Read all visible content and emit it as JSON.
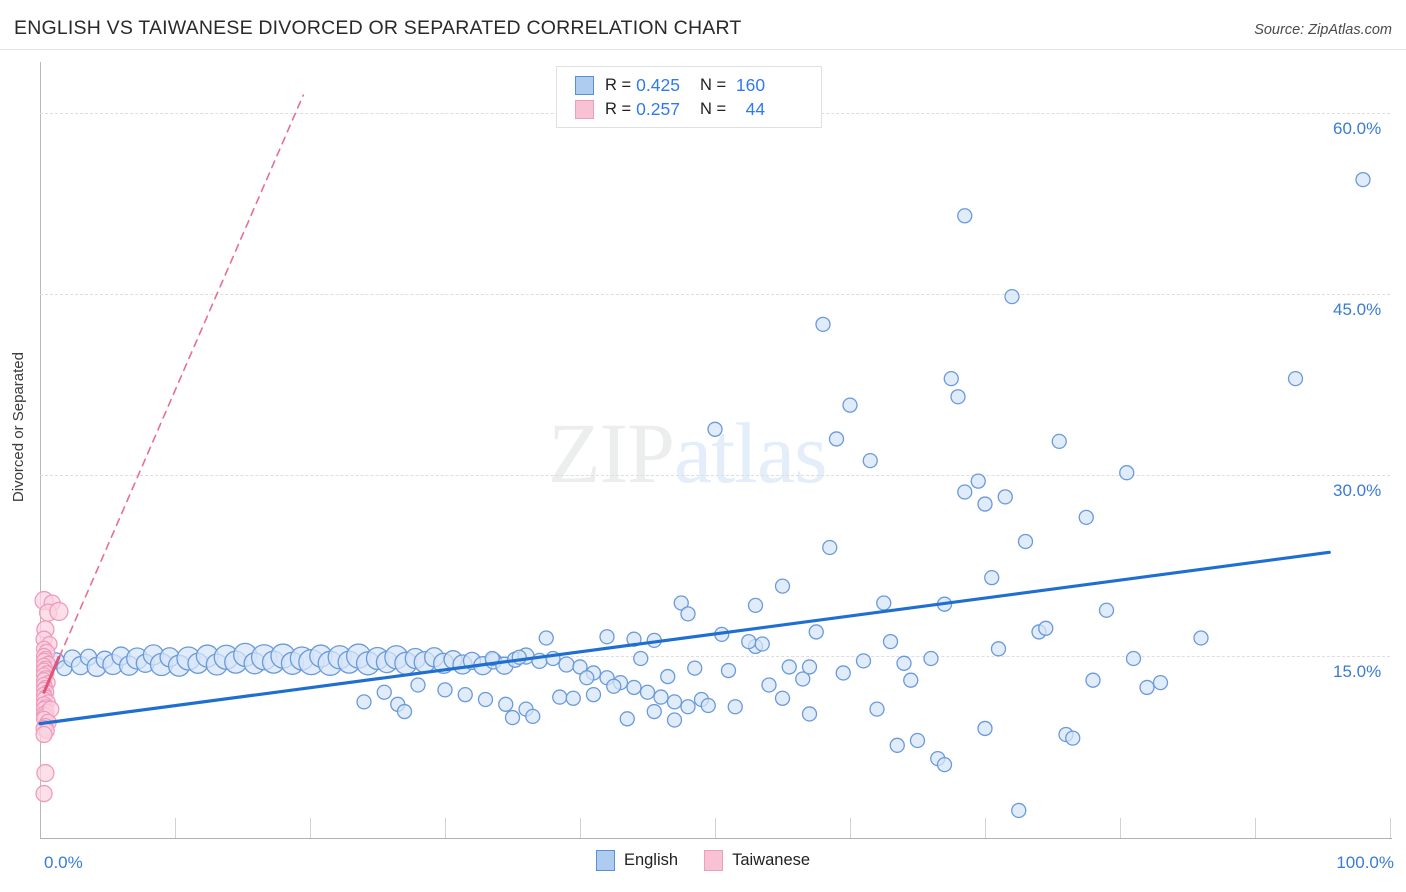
{
  "header": {
    "title": "ENGLISH VS TAIWANESE DIVORCED OR SEPARATED CORRELATION CHART",
    "source": "Source: ZipAtlas.com"
  },
  "watermark": {
    "part1": "ZIP",
    "part2": "atlas"
  },
  "legend_stats": {
    "rows": [
      {
        "series": "English",
        "color": "#aecbf0",
        "r_label": "R =",
        "r_value": "0.425",
        "n_label": "N =",
        "n_value": "160"
      },
      {
        "series": "Taiwanese",
        "color": "#f9c2d4",
        "r_label": "R =",
        "r_value": "0.257",
        "n_label": "N =",
        "n_value": "44"
      }
    ]
  },
  "bottom_legend": {
    "items": [
      {
        "label": "English",
        "color": "#aecbf0"
      },
      {
        "label": "Taiwanese",
        "color": "#f9c2d4"
      }
    ]
  },
  "axes": {
    "y_title": "Divorced or Separated",
    "y_ticks": [
      "60.0%",
      "45.0%",
      "30.0%",
      "15.0%"
    ],
    "x_min_label": "0.0%",
    "x_max_label": "100.0%"
  },
  "chart_data": {
    "type": "scatter",
    "title": "ENGLISH VS TAIWANESE DIVORCED OR SEPARATED CORRELATION CHART",
    "xlabel": "",
    "ylabel": "Divorced or Separated",
    "xlim": [
      0,
      100
    ],
    "ylim": [
      0,
      64
    ],
    "grid": true,
    "legend_position": "bottom-center",
    "x_tick_values": [
      0,
      10,
      20,
      30,
      40,
      50,
      60,
      70,
      80,
      90,
      100
    ],
    "y_tick_values": [
      15,
      30,
      45,
      60
    ],
    "series": [
      {
        "name": "English",
        "color": "#d6e5f8",
        "edge_color": "#6a9ada",
        "R": 0.425,
        "N": 160,
        "trendline": {
          "style": "solid",
          "color": "#1f6fd0",
          "x0": 0,
          "y0": 9.4,
          "x1": 95.5,
          "y1": 23.6
        },
        "points": [
          [
            0.5,
            14.3,
            14
          ],
          [
            1.2,
            14.6,
            16
          ],
          [
            1.8,
            14.0,
            15
          ],
          [
            2.4,
            14.8,
            17
          ],
          [
            3.0,
            14.2,
            18
          ],
          [
            3.6,
            14.9,
            16
          ],
          [
            4.2,
            14.1,
            19
          ],
          [
            4.8,
            14.7,
            17
          ],
          [
            5.4,
            14.3,
            20
          ],
          [
            6.0,
            15.0,
            18
          ],
          [
            6.6,
            14.2,
            19
          ],
          [
            7.2,
            14.8,
            21
          ],
          [
            7.8,
            14.4,
            18
          ],
          [
            8.4,
            15.1,
            20
          ],
          [
            9.0,
            14.3,
            22
          ],
          [
            9.6,
            14.9,
            19
          ],
          [
            10.3,
            14.2,
            21
          ],
          [
            11.0,
            14.8,
            23
          ],
          [
            11.7,
            14.4,
            20
          ],
          [
            12.4,
            15.0,
            22
          ],
          [
            13.1,
            14.3,
            21
          ],
          [
            13.8,
            14.9,
            24
          ],
          [
            14.5,
            14.5,
            22
          ],
          [
            15.2,
            15.1,
            23
          ],
          [
            15.9,
            14.4,
            21
          ],
          [
            16.6,
            14.9,
            25
          ],
          [
            17.3,
            14.5,
            22
          ],
          [
            18.0,
            15.0,
            24
          ],
          [
            18.7,
            14.4,
            22
          ],
          [
            19.4,
            14.8,
            23
          ],
          [
            20.1,
            14.5,
            25
          ],
          [
            20.8,
            15.0,
            22
          ],
          [
            21.5,
            14.4,
            24
          ],
          [
            22.2,
            14.9,
            23
          ],
          [
            22.9,
            14.5,
            22
          ],
          [
            23.6,
            15.0,
            24
          ],
          [
            24.3,
            14.4,
            23
          ],
          [
            25.0,
            14.8,
            22
          ],
          [
            25.7,
            14.5,
            21
          ],
          [
            26.4,
            14.9,
            23
          ],
          [
            27.1,
            14.4,
            22
          ],
          [
            27.8,
            14.8,
            20
          ],
          [
            28.5,
            14.5,
            21
          ],
          [
            29.2,
            14.9,
            19
          ],
          [
            29.9,
            14.4,
            20
          ],
          [
            30.6,
            14.7,
            18
          ],
          [
            31.3,
            14.3,
            19
          ],
          [
            32.0,
            14.6,
            17
          ],
          [
            32.8,
            14.2,
            18
          ],
          [
            33.6,
            14.6,
            16
          ],
          [
            34.4,
            14.2,
            17
          ],
          [
            35.2,
            14.7,
            15
          ],
          [
            36.0,
            15.0,
            16
          ],
          [
            37.0,
            14.6,
            15
          ],
          [
            38.0,
            14.8,
            14
          ],
          [
            39.0,
            14.3,
            15
          ],
          [
            40.0,
            14.1,
            14
          ],
          [
            41.0,
            13.6,
            14
          ],
          [
            42.0,
            13.2,
            14
          ],
          [
            43.0,
            12.8,
            14
          ],
          [
            44.0,
            12.4,
            14
          ],
          [
            45.0,
            12.0,
            14
          ],
          [
            46.0,
            11.6,
            14
          ],
          [
            47.0,
            11.2,
            14
          ],
          [
            48.0,
            10.8,
            14
          ],
          [
            49.0,
            11.4,
            14
          ],
          [
            26.5,
            11.0,
            14
          ],
          [
            28.0,
            12.6,
            14
          ],
          [
            30.0,
            12.2,
            14
          ],
          [
            31.5,
            11.8,
            14
          ],
          [
            33.0,
            11.4,
            14
          ],
          [
            34.5,
            11.0,
            14
          ],
          [
            36.0,
            10.6,
            14
          ],
          [
            24.0,
            11.2,
            14
          ],
          [
            25.5,
            12.0,
            14
          ],
          [
            35.0,
            9.9,
            14
          ],
          [
            36.5,
            10.0,
            14
          ],
          [
            27.0,
            10.4,
            14
          ],
          [
            38.5,
            11.6,
            14
          ],
          [
            39.5,
            11.5,
            14
          ],
          [
            41.0,
            11.8,
            14
          ],
          [
            43.5,
            9.8,
            14
          ],
          [
            45.5,
            10.4,
            14
          ],
          [
            47.0,
            9.7,
            14
          ],
          [
            49.5,
            10.9,
            14
          ],
          [
            51.5,
            10.8,
            14
          ],
          [
            50.5,
            16.8,
            14
          ],
          [
            53.0,
            15.8,
            14
          ],
          [
            54.0,
            12.6,
            14
          ],
          [
            55.0,
            11.5,
            14
          ],
          [
            57.0,
            10.2,
            14
          ],
          [
            42.5,
            12.5,
            14
          ],
          [
            37.5,
            16.5,
            14
          ],
          [
            44.5,
            14.8,
            14
          ],
          [
            40.5,
            13.2,
            14
          ],
          [
            46.5,
            13.3,
            14
          ],
          [
            48.5,
            14.0,
            14
          ],
          [
            51.0,
            13.8,
            14
          ],
          [
            52.5,
            16.2,
            14
          ],
          [
            53.5,
            16.0,
            14
          ],
          [
            55.5,
            14.1,
            14
          ],
          [
            56.5,
            13.1,
            14
          ],
          [
            47.5,
            19.4,
            14
          ],
          [
            50.0,
            33.8,
            14
          ],
          [
            48.0,
            18.5,
            14
          ],
          [
            53.0,
            19.2,
            14
          ],
          [
            55.0,
            20.8,
            14
          ],
          [
            57.5,
            17.0,
            14
          ],
          [
            58.5,
            24.0,
            14
          ],
          [
            60.0,
            35.8,
            14
          ],
          [
            59.0,
            33.0,
            14
          ],
          [
            61.0,
            14.6,
            14
          ],
          [
            57.0,
            14.1,
            14
          ],
          [
            59.5,
            13.6,
            14
          ],
          [
            61.5,
            31.2,
            14
          ],
          [
            58.0,
            42.5,
            14
          ],
          [
            62.5,
            19.4,
            14
          ],
          [
            63.0,
            16.2,
            14
          ],
          [
            62.0,
            10.6,
            14
          ],
          [
            64.0,
            14.4,
            14
          ],
          [
            64.5,
            13.0,
            14
          ],
          [
            63.5,
            7.6,
            14
          ],
          [
            65.0,
            8.0,
            14
          ],
          [
            66.0,
            14.8,
            14
          ],
          [
            67.0,
            19.3,
            14
          ],
          [
            68.5,
            28.6,
            14
          ],
          [
            69.5,
            29.5,
            14
          ],
          [
            67.5,
            38.0,
            14
          ],
          [
            68.0,
            36.5,
            14
          ],
          [
            70.0,
            27.6,
            14
          ],
          [
            66.5,
            6.5,
            14
          ],
          [
            67.0,
            6.0,
            14
          ],
          [
            68.5,
            51.5,
            14
          ],
          [
            70.5,
            21.5,
            14
          ],
          [
            71.0,
            15.6,
            14
          ],
          [
            72.0,
            44.8,
            14
          ],
          [
            71.5,
            28.2,
            14
          ],
          [
            73.0,
            24.5,
            14
          ],
          [
            70.0,
            9.0,
            14
          ],
          [
            72.5,
            2.2,
            14
          ],
          [
            74.0,
            17.0,
            14
          ],
          [
            74.5,
            17.3,
            14
          ],
          [
            75.5,
            32.8,
            14
          ],
          [
            76.0,
            8.5,
            14
          ],
          [
            76.5,
            8.2,
            14
          ],
          [
            77.5,
            26.5,
            14
          ],
          [
            78.0,
            13.0,
            14
          ],
          [
            79.0,
            18.8,
            14
          ],
          [
            80.5,
            30.2,
            14
          ],
          [
            81.0,
            14.8,
            14
          ],
          [
            82.0,
            12.4,
            14
          ],
          [
            83.0,
            12.8,
            14
          ],
          [
            86.0,
            16.5,
            14
          ],
          [
            93.0,
            38.0,
            14
          ],
          [
            98.0,
            54.5,
            14
          ],
          [
            44.0,
            16.4,
            14
          ],
          [
            45.5,
            16.3,
            14
          ],
          [
            42.0,
            16.6,
            14
          ],
          [
            35.5,
            14.9,
            14
          ],
          [
            33.5,
            14.8,
            14
          ]
        ]
      },
      {
        "name": "Taiwanese",
        "color": "#fbd2e0",
        "edge_color": "#ef9cbc",
        "R": 0.257,
        "N": 44,
        "trendline": {
          "style": "dashed",
          "color": "#e8708f",
          "x0": 0.3,
          "y0": 12.0,
          "x1": 19.5,
          "y1": 61.5
        },
        "points": [
          [
            0.3,
            19.6,
            18
          ],
          [
            0.9,
            19.4,
            16
          ],
          [
            0.6,
            18.6,
            17
          ],
          [
            1.4,
            18.7,
            18
          ],
          [
            0.4,
            17.2,
            17
          ],
          [
            0.3,
            16.4,
            16
          ],
          [
            0.7,
            16.0,
            15
          ],
          [
            0.3,
            15.6,
            15
          ],
          [
            0.5,
            15.3,
            16
          ],
          [
            0.3,
            15.0,
            15
          ],
          [
            0.4,
            14.8,
            14
          ],
          [
            0.3,
            14.6,
            15
          ],
          [
            0.6,
            14.4,
            14
          ],
          [
            0.3,
            14.2,
            15
          ],
          [
            0.4,
            14.0,
            14
          ],
          [
            0.3,
            13.8,
            15
          ],
          [
            0.5,
            13.6,
            14
          ],
          [
            0.3,
            13.4,
            15
          ],
          [
            0.4,
            13.2,
            14
          ],
          [
            0.3,
            13.0,
            15
          ],
          [
            0.6,
            12.8,
            14
          ],
          [
            0.3,
            12.6,
            15
          ],
          [
            0.4,
            12.4,
            14
          ],
          [
            0.3,
            12.2,
            15
          ],
          [
            0.5,
            12.0,
            14
          ],
          [
            0.3,
            11.8,
            15
          ],
          [
            0.4,
            11.6,
            14
          ],
          [
            0.3,
            11.4,
            15
          ],
          [
            0.6,
            11.2,
            14
          ],
          [
            0.3,
            11.0,
            15
          ],
          [
            0.4,
            10.8,
            14
          ],
          [
            0.3,
            10.6,
            15
          ],
          [
            0.5,
            10.4,
            14
          ],
          [
            0.3,
            10.2,
            15
          ],
          [
            0.4,
            10.0,
            16
          ],
          [
            0.8,
            10.6,
            16
          ],
          [
            0.3,
            9.8,
            15
          ],
          [
            0.6,
            9.5,
            16
          ],
          [
            0.4,
            9.2,
            15
          ],
          [
            0.3,
            9.0,
            16
          ],
          [
            0.5,
            8.8,
            15
          ],
          [
            0.3,
            8.5,
            16
          ],
          [
            0.4,
            5.3,
            17
          ],
          [
            0.3,
            3.6,
            16
          ]
        ]
      }
    ]
  }
}
